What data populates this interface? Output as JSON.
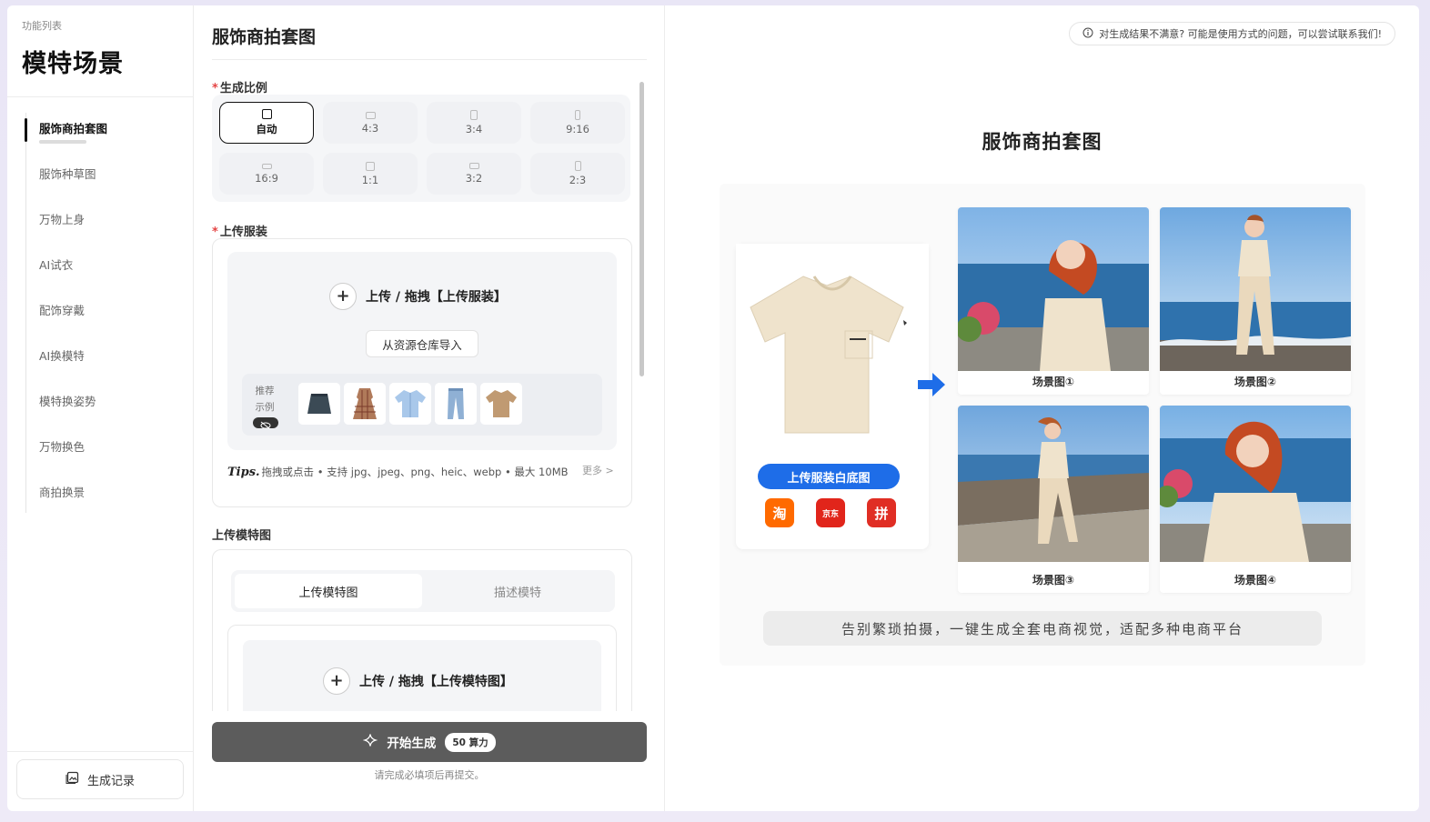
{
  "sidebar": {
    "caption": "功能列表",
    "title": "模特场景",
    "items": [
      {
        "label": "服饰商拍套图",
        "active": true
      },
      {
        "label": "服饰种草图",
        "active": false
      },
      {
        "label": "万物上身",
        "active": false
      },
      {
        "label": "AI试衣",
        "active": false
      },
      {
        "label": "配饰穿戴",
        "active": false
      },
      {
        "label": "AI换模特",
        "active": false
      },
      {
        "label": "模特换姿势",
        "active": false
      },
      {
        "label": "万物换色",
        "active": false
      },
      {
        "label": "商拍换景",
        "active": false
      }
    ],
    "record_label": "生成记录"
  },
  "form": {
    "title": "服饰商拍套图",
    "ratio_label": "生成比例",
    "ratios": [
      {
        "label": "自动",
        "active": true
      },
      {
        "label": "4:3"
      },
      {
        "label": "3:4"
      },
      {
        "label": "9:16"
      },
      {
        "label": "16:9"
      },
      {
        "label": "1:1"
      },
      {
        "label": "3:2"
      },
      {
        "label": "2:3"
      }
    ],
    "upload_label": "上传服装",
    "upload_action": "上传 / 拖拽【上传服装】",
    "import_label": "从资源仓库导入",
    "examples_label_1": "推荐",
    "examples_label_2": "示例",
    "tips_prefix": "Tips.",
    "tips_text": "拖拽或点击 • 支持 jpg、jpeg、png、heic、webp • 最大 10MB",
    "more_label": "更多 >",
    "model_label": "上传模特图",
    "model_tabs": [
      {
        "label": "上传模特图",
        "active": true
      },
      {
        "label": "描述模特",
        "active": false
      }
    ],
    "model_upload_action": "上传 / 拖拽【上传模特图】",
    "generate_label": "开始生成",
    "generate_cost": "50 算力",
    "generate_hint": "请完成必填项后再提交。"
  },
  "preview": {
    "notice": "对生成结果不满意? 可能是使用方式的问题，可以尝试联系我们!",
    "title": "服饰商拍套图",
    "product_button": "上传服装白底图",
    "scenes": [
      "场景图①",
      "场景图②",
      "场景图③",
      "场景图④"
    ],
    "slogan": "告别繁琐拍摄，一键生成全套电商视觉，适配多种电商平台",
    "logos": [
      {
        "name": "taobao-logo",
        "glyph": "淘",
        "color": "#ff6a00"
      },
      {
        "name": "jd-logo",
        "glyph": "京东",
        "color": "#e1251b"
      },
      {
        "name": "pinduoduo-logo",
        "glyph": "拼",
        "color": "#e02e24"
      }
    ],
    "accent": "#1e6de8"
  }
}
